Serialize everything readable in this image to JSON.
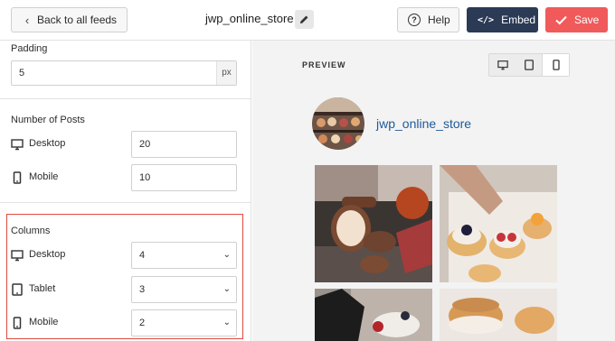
{
  "header": {
    "back_label": "Back to all feeds",
    "feed_title": "jwp_online_store",
    "help_label": "Help",
    "embed_label": "Embed",
    "save_label": "Save"
  },
  "padding": {
    "label": "Padding",
    "value": "5",
    "unit": "px"
  },
  "posts": {
    "label": "Number of Posts",
    "desktop_label": "Desktop",
    "desktop_value": "20",
    "mobile_label": "Mobile",
    "mobile_value": "10"
  },
  "columns": {
    "label": "Columns",
    "desktop_label": "Desktop",
    "desktop_value": "4",
    "tablet_label": "Tablet",
    "tablet_value": "3",
    "mobile_label": "Mobile",
    "mobile_value": "2"
  },
  "preview": {
    "label": "PREVIEW",
    "username": "jwp_online_store"
  },
  "colors": {
    "embed_bg": "#2b3a55",
    "save_bg": "#f05a5a",
    "highlight": "#e04a3f",
    "username": "#1e5a9a"
  }
}
